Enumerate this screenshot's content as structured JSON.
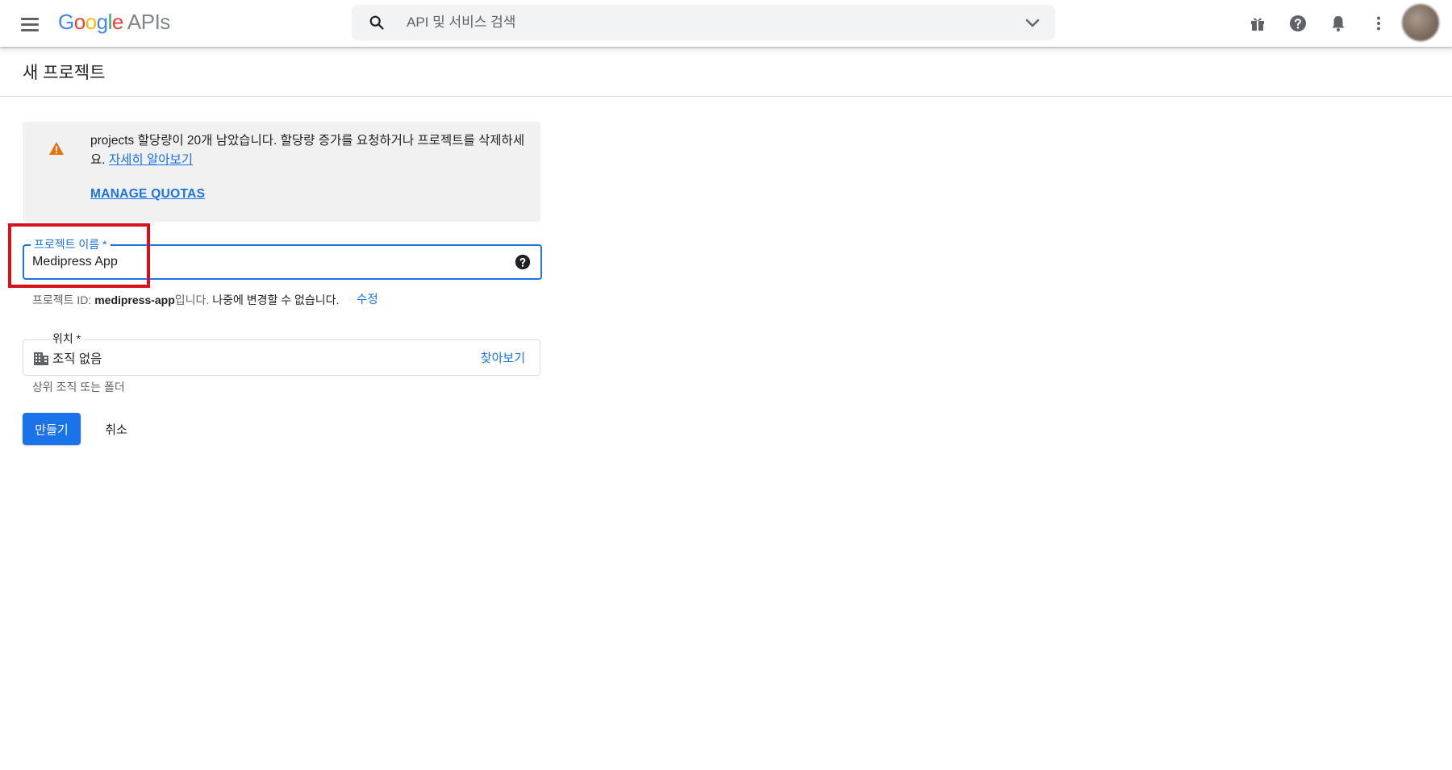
{
  "topbar": {
    "logo": {
      "google": [
        "G",
        "o",
        "o",
        "g",
        "l",
        "e"
      ],
      "suffix": "APIs"
    },
    "search_placeholder": "API 및 서비스 검색",
    "icons": [
      "menu-icon",
      "search-icon",
      "chevron-down-icon",
      "gift-icon",
      "help-icon",
      "notifications-bell-icon",
      "more-vert-icon"
    ]
  },
  "page": {
    "title": "새 프로젝트"
  },
  "quota_notice": {
    "text": "projects 할당량이 20개 남았습니다. 할당량 증가를 요청하거나 프로젝트를 삭제하세요.",
    "learn_more": "자세히 알아보기",
    "manage_quotas": "MANAGE QUOTAS"
  },
  "project_name_field": {
    "label": "프로젝트 이름 *",
    "value": "Medipress App"
  },
  "project_id_hint": {
    "prefix": "프로젝트 ID: ",
    "id": "medipress-app",
    "suffix": "입니다. ",
    "note": "나중에 변경할 수 없습니다.",
    "edit": "수정"
  },
  "location_field": {
    "label": "위치 *",
    "value": "조직 없음",
    "browse": "찾아보기",
    "hint": "상위 조직 또는 폴더"
  },
  "actions": {
    "create": "만들기",
    "cancel": "취소"
  },
  "colors": {
    "accent": "#1a73e8",
    "warning": "#e8710a",
    "highlight_box": "#d6111b",
    "notice_bg": "#f1f1f1"
  }
}
